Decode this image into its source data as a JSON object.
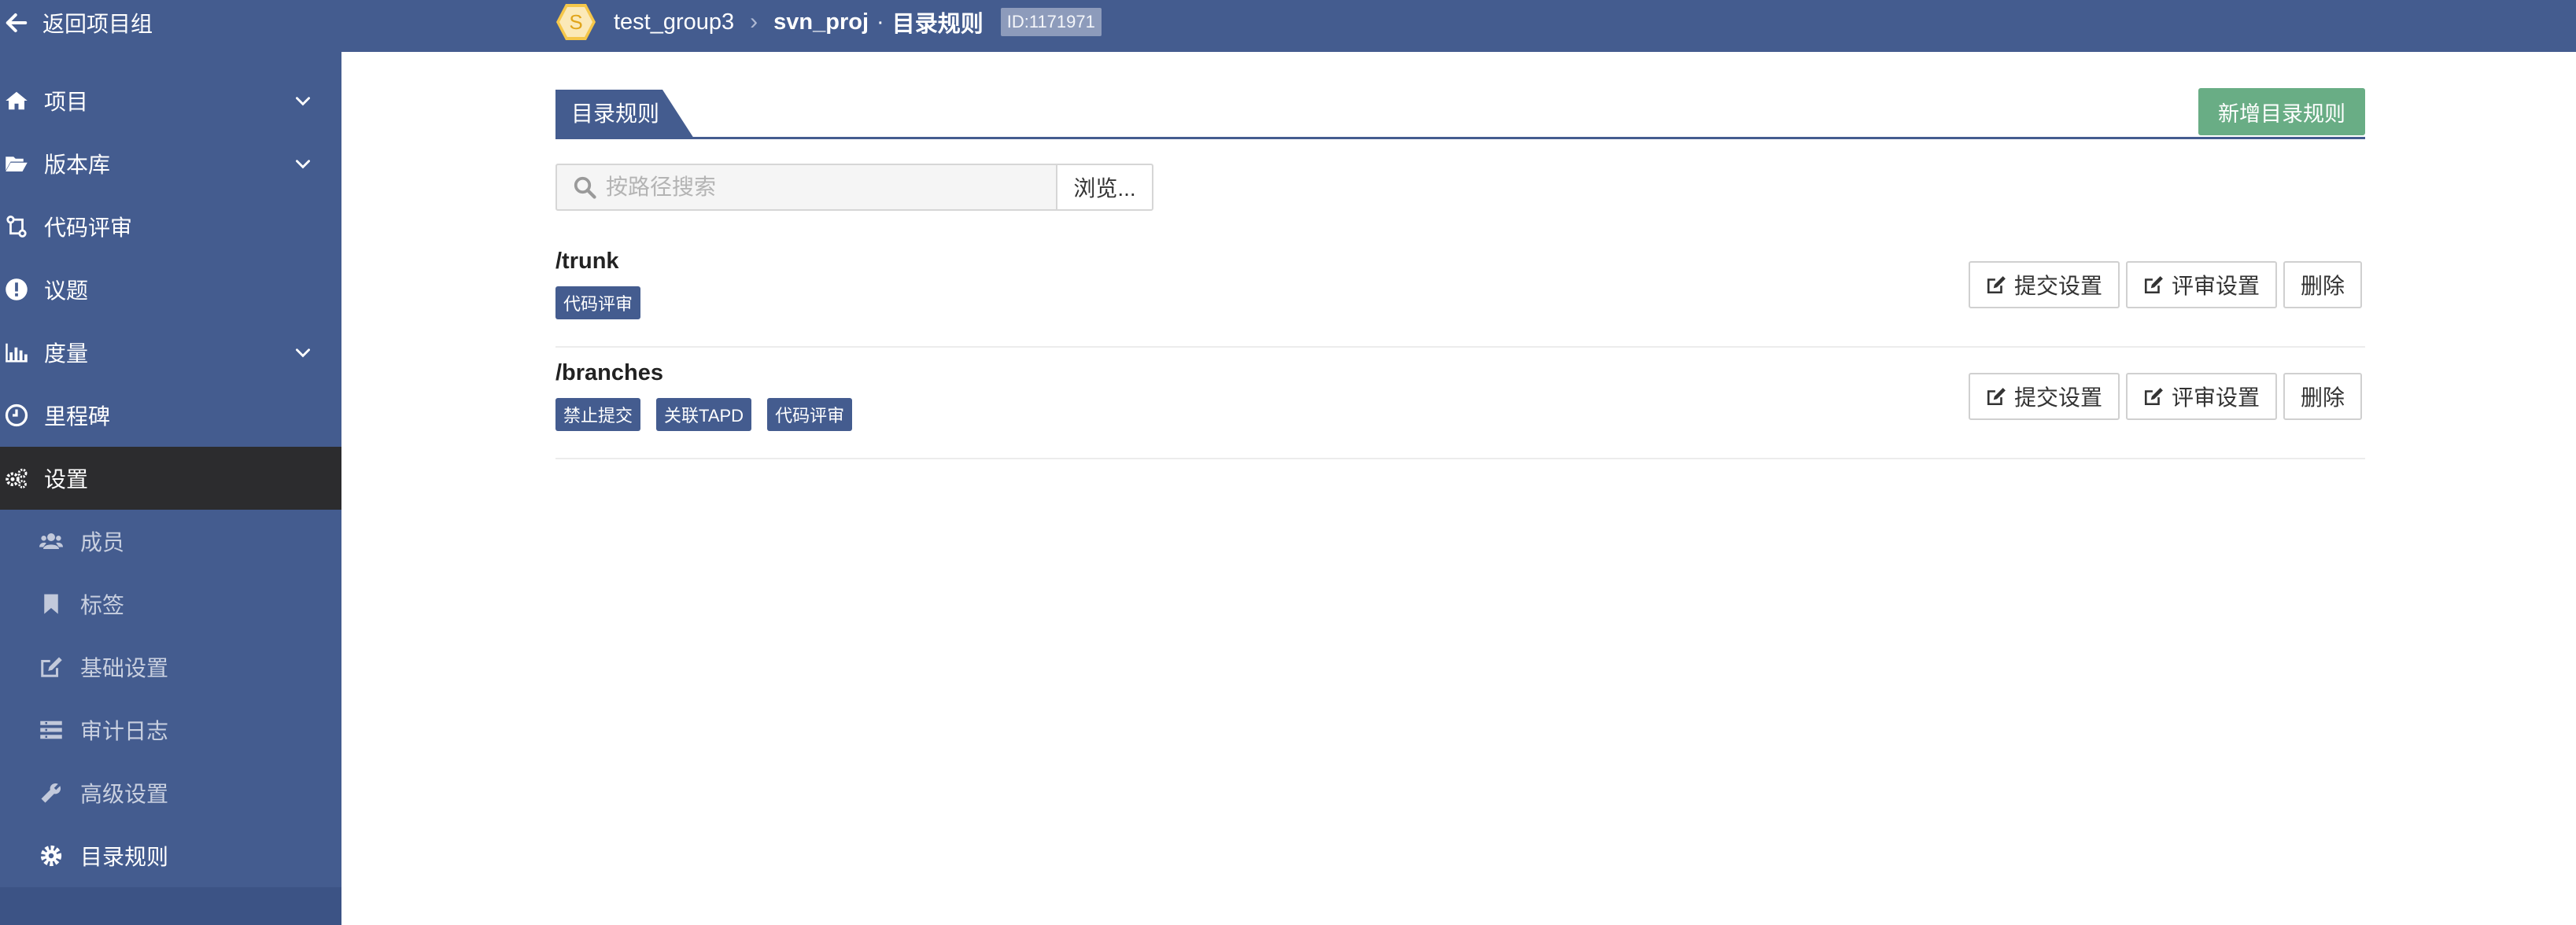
{
  "topbar": {
    "back_label": "返回项目组",
    "group_initial": "S",
    "group_name": "test_group3",
    "project_name": "svn_proj",
    "separator_dot": "·",
    "page_name": "目录规则",
    "id_badge": "ID:1171971"
  },
  "sidebar": {
    "items": [
      {
        "label": "项目",
        "icon": "home-icon",
        "has_chevron": true
      },
      {
        "label": "版本库",
        "icon": "folder-open-icon",
        "has_chevron": true
      },
      {
        "label": "代码评审",
        "icon": "code-review-icon",
        "has_chevron": false
      },
      {
        "label": "议题",
        "icon": "exclamation-circle-icon",
        "has_chevron": false
      },
      {
        "label": "度量",
        "icon": "bar-chart-icon",
        "has_chevron": true
      },
      {
        "label": "里程碑",
        "icon": "clock-icon",
        "has_chevron": false
      },
      {
        "label": "设置",
        "icon": "gears-icon",
        "has_chevron": false,
        "active": true
      }
    ],
    "sub_items": [
      {
        "label": "成员",
        "icon": "users-icon"
      },
      {
        "label": "标签",
        "icon": "bookmark-icon"
      },
      {
        "label": "基础设置",
        "icon": "edit-icon"
      },
      {
        "label": "审计日志",
        "icon": "list-icon"
      },
      {
        "label": "高级设置",
        "icon": "wrench-icon"
      },
      {
        "label": "目录规则",
        "icon": "gear-icon",
        "current": true
      }
    ]
  },
  "main": {
    "tab_label": "目录规则",
    "add_button": "新增目录规则",
    "search_placeholder": "按路径搜索",
    "browse_button": "浏览...",
    "rules": [
      {
        "path": "/trunk",
        "tags": [
          "代码评审"
        ],
        "actions": {
          "commit": "提交设置",
          "review": "评审设置",
          "delete": "删除"
        }
      },
      {
        "path": "/branches",
        "tags": [
          "禁止提交",
          "关联TAPD",
          "代码评审"
        ],
        "actions": {
          "commit": "提交设置",
          "review": "评审设置",
          "delete": "删除"
        }
      }
    ]
  },
  "colors": {
    "primary": "#445c8f",
    "active_nav": "#2c2c2e",
    "success_button": "#69ad85",
    "group_icon": "#f5c74a"
  }
}
